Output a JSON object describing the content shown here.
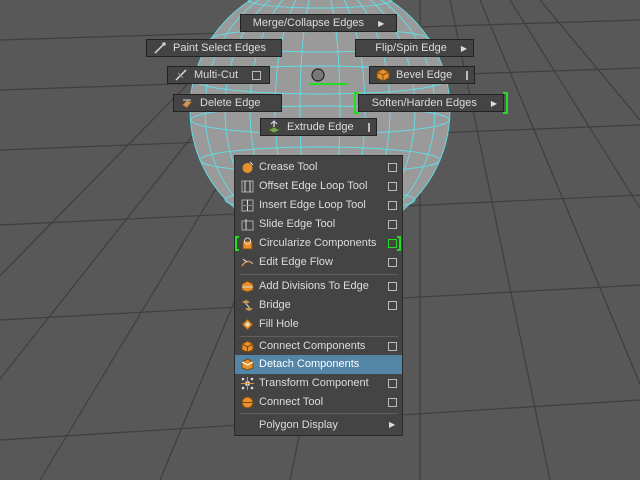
{
  "marking_menu": {
    "north": "Merge/Collapse Edges",
    "northwest": "Paint Select Edges",
    "northeast": "Flip/Spin Edge",
    "west": "Multi-Cut",
    "east": "Bevel Edge",
    "southwest": "Delete Edge",
    "southeast": "Soften/Harden Edges",
    "south": "Extrude Edge"
  },
  "menu": {
    "items": [
      {
        "label": "Crease Tool",
        "icon": "crease-icon"
      },
      {
        "label": "Offset Edge Loop Tool",
        "icon": "offset-edge-loop-icon"
      },
      {
        "label": "Insert Edge Loop Tool",
        "icon": "insert-edge-loop-icon"
      },
      {
        "label": "Slide Edge Tool",
        "icon": "slide-edge-icon"
      },
      {
        "label": "Circularize Components",
        "icon": "circularize-icon"
      },
      {
        "label": "Edit Edge Flow",
        "icon": "edit-edge-flow-icon"
      },
      {
        "label": "Add Divisions To Edge",
        "icon": "add-divisions-icon"
      },
      {
        "label": "Bridge",
        "icon": "bridge-icon"
      },
      {
        "label": "Fill Hole",
        "icon": "fill-hole-icon"
      },
      {
        "label": "Connect Components",
        "icon": "connect-components-icon"
      },
      {
        "label": "Detach Components",
        "icon": "detach-components-icon"
      },
      {
        "label": "Transform Component",
        "icon": "transform-component-icon"
      },
      {
        "label": "Connect Tool",
        "icon": "connect-tool-icon"
      },
      {
        "label": "Polygon Display"
      }
    ],
    "selected": "Detach Components"
  },
  "colors": {
    "viewport_bg": "#555555",
    "grid": "#3e3e3e",
    "wireframe": "#5fe0e8",
    "menu_bg": "#444444",
    "highlight": "#5285a6",
    "green_marker": "#22dd22",
    "accent_orange": "#e8912c"
  }
}
